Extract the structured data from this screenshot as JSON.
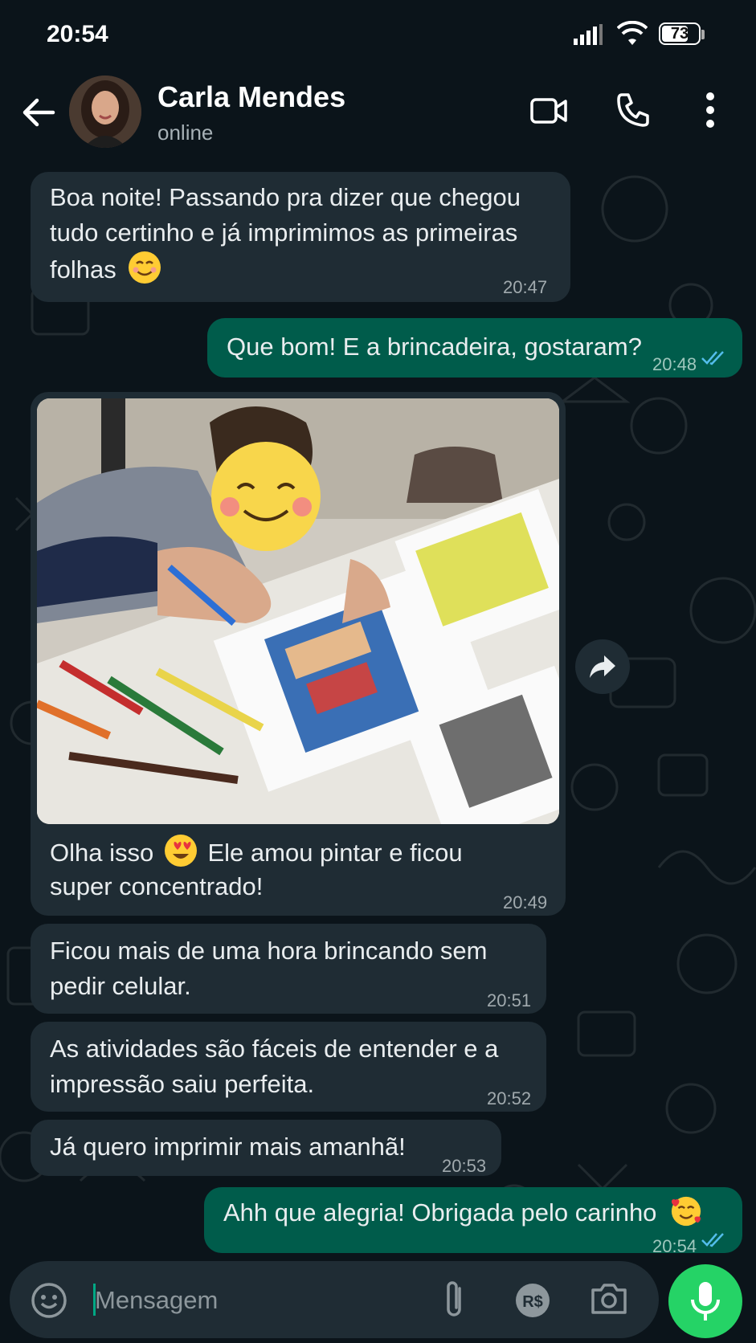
{
  "status_bar": {
    "time": "20:54",
    "battery": "73",
    "battery_level": 0.73
  },
  "header": {
    "name": "Carla Mendes",
    "status": "online"
  },
  "messages": [
    {
      "dir": "in",
      "line1": "Boa noite! Passando pra dizer que chegou",
      "line2": "tudo certinho e já imprimimos as primeiras",
      "line3": "folhas",
      "emoji": "smiling-face",
      "time": "20:47"
    },
    {
      "dir": "out",
      "text": "Que bom! E a brincadeira, gostaram?",
      "time": "20:48",
      "status": "read"
    },
    {
      "dir": "in",
      "media": "photo",
      "line1a": "Olha isso",
      "line1b": "Ele amou pintar e ficou",
      "line2": "super concentrado!",
      "emoji": "heart-eyes",
      "time": "20:49"
    },
    {
      "dir": "in",
      "line1": "Ficou mais de uma hora brincando sem",
      "line2": "pedir celular.",
      "time": "20:51"
    },
    {
      "dir": "in",
      "line1": "As atividades são fáceis de entender e a",
      "line2": "impressão saiu perfeita.",
      "time": "20:52"
    },
    {
      "dir": "in",
      "text": "Já quero imprimir mais amanhã!",
      "time": "20:53"
    },
    {
      "dir": "out",
      "text": "Ahh que alegria! Obrigada pelo carinho",
      "emoji": "smiling-face-with-hearts",
      "time": "20:54",
      "status": "read"
    }
  ],
  "input": {
    "placeholder": "Mensagem",
    "value": ""
  },
  "icons": {
    "back": "arrow-left-icon",
    "video": "video-call-icon",
    "call": "phone-icon",
    "more": "more-vertical-icon",
    "emoji": "emoji-icon",
    "attach": "paperclip-icon",
    "payment": "pix-rs-icon",
    "camera": "camera-icon",
    "mic": "microphone-icon",
    "forward": "forward-icon"
  },
  "colors": {
    "background": "#0b141a",
    "incoming": "#1f2c34",
    "outgoing": "#005c4b",
    "accent": "#25d366",
    "read_ticks": "#53bdeb"
  }
}
